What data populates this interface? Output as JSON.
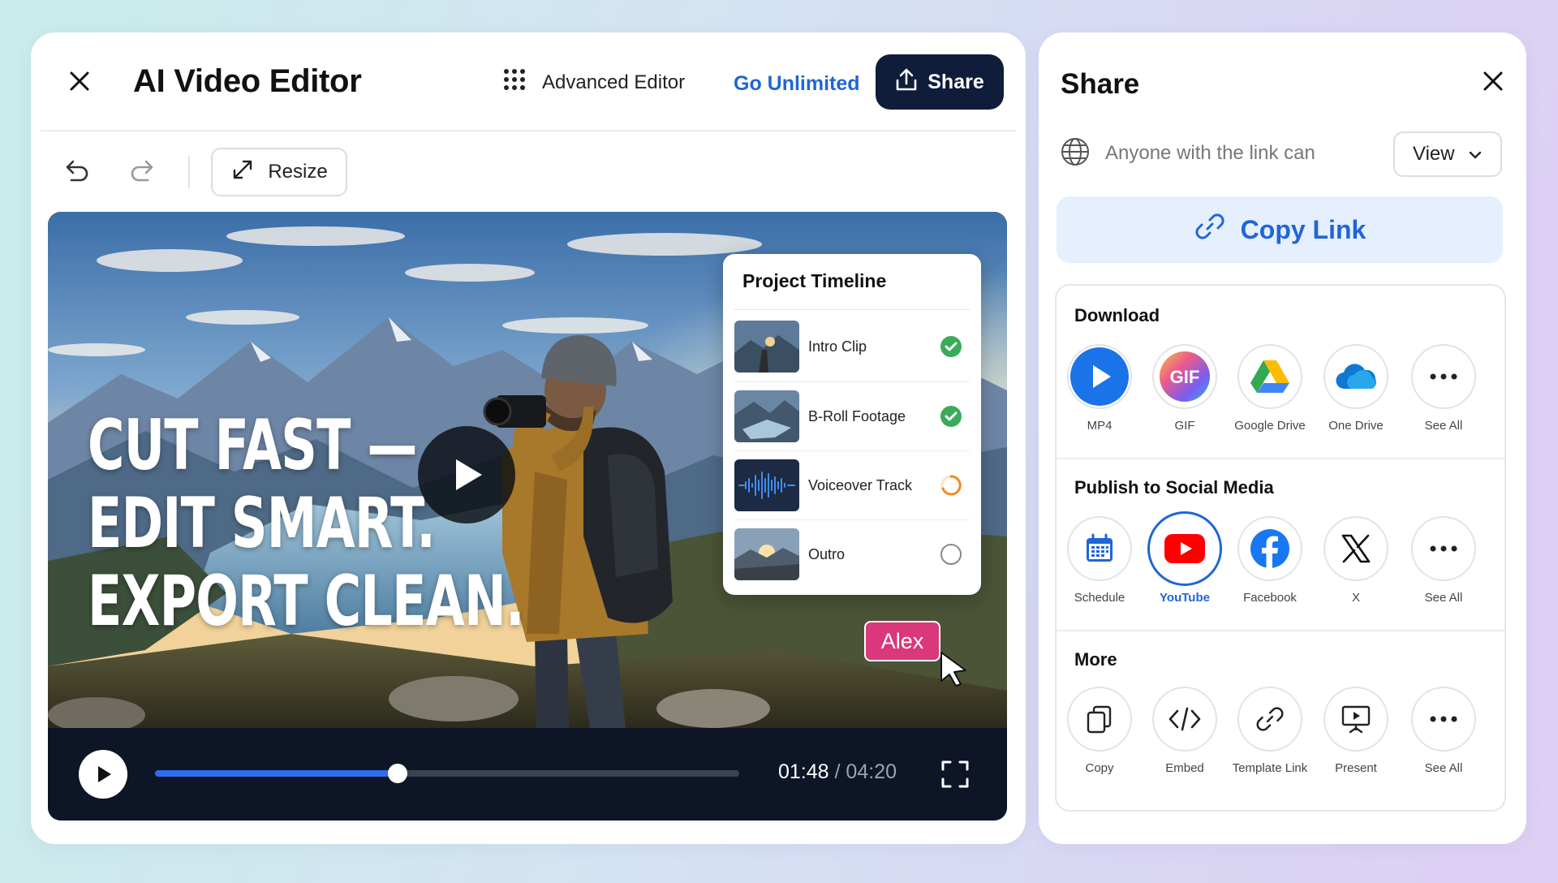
{
  "editor": {
    "title": "AI Video Editor",
    "advanced_editor": "Advanced Editor",
    "go_unlimited": "Go Unlimited",
    "share_label": "Share",
    "resize_label": "Resize"
  },
  "video": {
    "headline": [
      "CUT FAST —",
      "EDIT SMART.",
      "EXPORT CLEAN."
    ],
    "timeline": {
      "title": "Project Timeline",
      "items": [
        {
          "label": "Intro Clip",
          "status": "done"
        },
        {
          "label": "B-Roll Footage",
          "status": "done"
        },
        {
          "label": "Voiceover Track",
          "status": "in-progress"
        },
        {
          "label": "Outro",
          "status": "pending"
        }
      ]
    },
    "collaborator": "Alex",
    "current_time": "01:48",
    "separator": "/",
    "total_time": "04:20",
    "progress": 0.4154,
    "colors": {
      "accent": "#2f6df0",
      "collaborator": "#d9387b",
      "done": "#3aab5a",
      "in_progress": "#f28a1e"
    }
  },
  "share": {
    "title": "Share",
    "access_text": "Anyone with the link can",
    "permission": "View",
    "copy_link": "Copy Link",
    "sections": [
      {
        "title": "Download",
        "options": [
          {
            "label": "MP4",
            "icon": "play-icon"
          },
          {
            "label": "GIF",
            "icon": "gif-icon"
          },
          {
            "label": "Google Drive",
            "icon": "google-drive-icon"
          },
          {
            "label": "One Drive",
            "icon": "onedrive-icon"
          },
          {
            "label": "See All",
            "icon": "more-icon"
          }
        ]
      },
      {
        "title": "Publish to Social Media",
        "options": [
          {
            "label": "Schedule",
            "icon": "calendar-icon"
          },
          {
            "label": "YouTube",
            "icon": "youtube-icon",
            "selected": true
          },
          {
            "label": "Facebook",
            "icon": "facebook-icon"
          },
          {
            "label": "X",
            "icon": "x-icon"
          },
          {
            "label": "See All",
            "icon": "more-icon"
          }
        ]
      },
      {
        "title": "More",
        "options": [
          {
            "label": "Copy",
            "icon": "copy-icon"
          },
          {
            "label": "Embed",
            "icon": "embed-icon"
          },
          {
            "label": "Template Link",
            "icon": "link-icon"
          },
          {
            "label": "Present",
            "icon": "present-icon"
          },
          {
            "label": "See All",
            "icon": "more-icon"
          }
        ]
      }
    ],
    "colors": {
      "brand_blue": "#1f66d6",
      "copy_link_bg": "#e6effd",
      "share_button": "#0f1d3a"
    }
  }
}
